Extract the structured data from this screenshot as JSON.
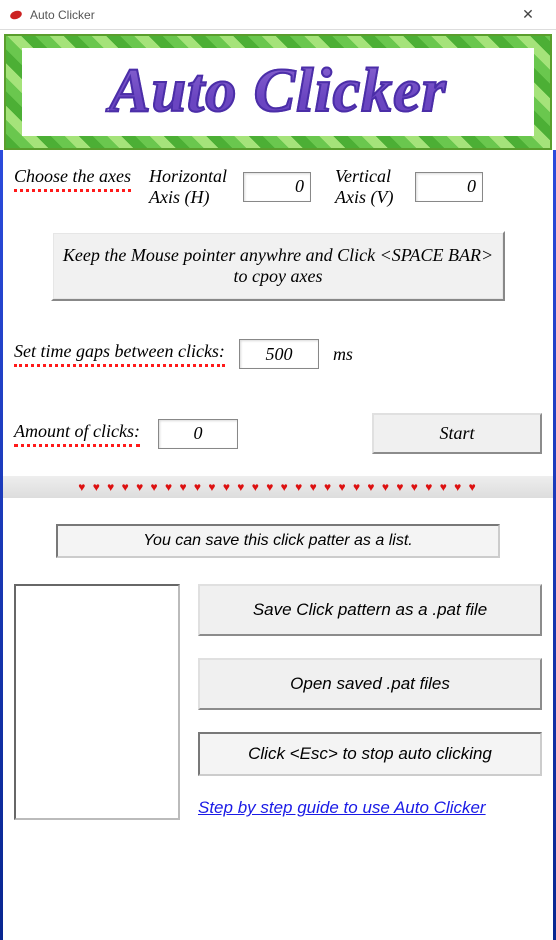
{
  "window": {
    "title": "Auto Clicker",
    "banner": "Auto Clicker"
  },
  "axes": {
    "label": "Choose the axes",
    "h_label": "Horizontal Axis (H)",
    "h_value": "0",
    "v_label": "Vertical Axis (V)",
    "v_value": "0"
  },
  "hint_copy": "Keep the Mouse pointer anywhre and Click <SPACE BAR> to cpoy axes",
  "gap": {
    "label": "Set time gaps between clicks:",
    "value": "500",
    "unit": "ms"
  },
  "clicks": {
    "label": "Amount of clicks:",
    "value": "0"
  },
  "start_label": "Start",
  "save_hint": "You can save this click patter as a list.",
  "buttons": {
    "save_pattern": "Save Click pattern as a .pat file",
    "open_pat": "Open saved .pat files"
  },
  "esc_hint": "Click <Esc> to stop auto clicking",
  "guide_link": "Step by step guide to use Auto Clicker"
}
